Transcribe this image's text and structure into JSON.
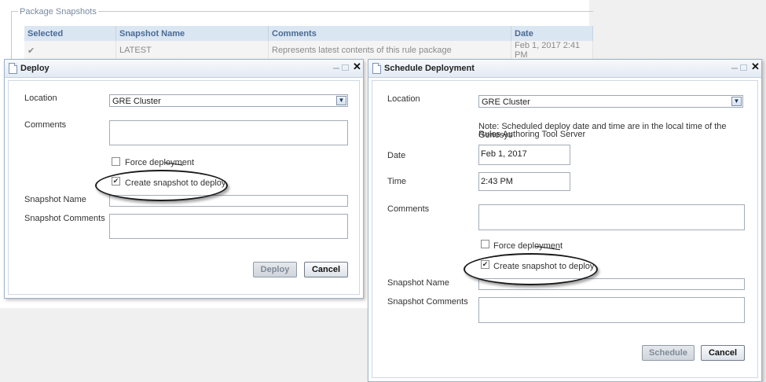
{
  "background": {
    "legend": "Package Snapshots",
    "table": {
      "headers": [
        "Selected",
        "Snapshot Name",
        "Comments",
        "Date"
      ],
      "rows": [
        {
          "selected": "✔",
          "name": "LATEST",
          "comments": "Represents latest contents of this rule package",
          "date": "Feb 1, 2017 2:41 PM"
        }
      ]
    }
  },
  "deploy_dialog": {
    "title": "Deploy",
    "location_label": "Location",
    "location_value": "GRE Cluster",
    "comments_label": "Comments",
    "force_label": "Force deployment",
    "force_checked": false,
    "create_snapshot_label": "Create snapshot to deploy",
    "create_snapshot_checked": "✔",
    "snapshot_name_label": "Snapshot Name",
    "snapshot_comments_label": "Snapshot Comments",
    "deploy_button": "Deploy",
    "cancel_button": "Cancel"
  },
  "schedule_dialog": {
    "title": "Schedule Deployment",
    "location_label": "Location",
    "location_value": "GRE Cluster",
    "note_line1": "Note: Scheduled deploy date and time are in the local time of the Genesys",
    "note_line2": "Rules Authoring Tool Server",
    "date_label": "Date",
    "date_value": "Feb 1, 2017",
    "time_label": "Time",
    "time_value": "2:43 PM",
    "comments_label": "Comments",
    "force_label": "Force deployment",
    "create_snapshot_label": "Create snapshot to deploy",
    "create_snapshot_checked": "✔",
    "snapshot_name_label": "Snapshot Name",
    "snapshot_comments_label": "Snapshot Comments",
    "schedule_button": "Schedule",
    "cancel_button": "Cancel"
  },
  "icons": {
    "close": "✕",
    "dropdown": "chevron-down"
  },
  "colors": {
    "header_blue": "#dbe6f3",
    "dialog_border": "#9eb3cc"
  }
}
